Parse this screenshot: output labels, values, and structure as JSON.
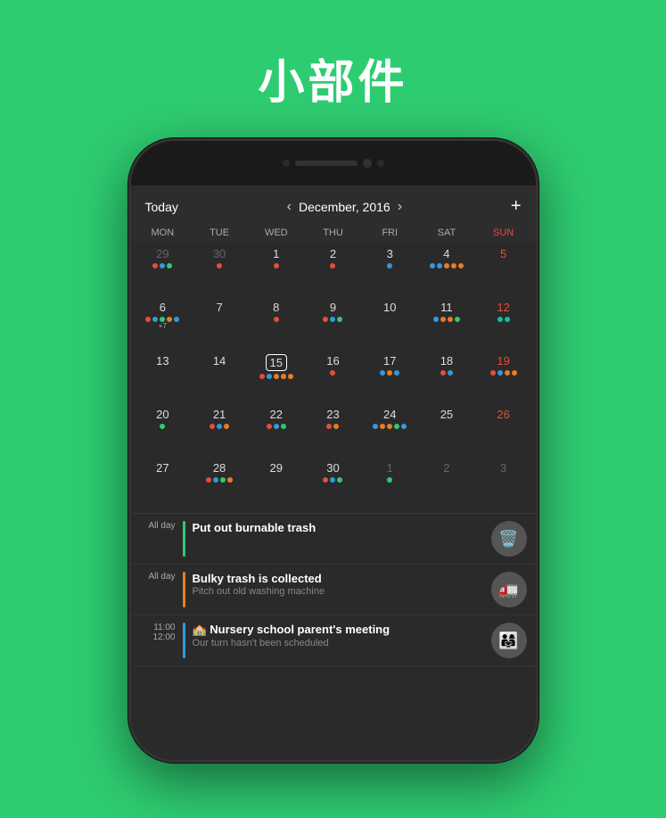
{
  "page": {
    "title": "小部件",
    "background_color": "#2ecc71"
  },
  "calendar": {
    "today_label": "Today",
    "month_label": "December, 2016",
    "prev_arrow": "‹",
    "next_arrow": "›",
    "add_btn": "+",
    "day_headers": [
      "MON",
      "TUE",
      "WED",
      "THU",
      "FRI",
      "SAT",
      "SUN"
    ],
    "weeks": [
      [
        {
          "num": "29",
          "dots": [
            "red",
            "blue",
            "green"
          ],
          "other": true
        },
        {
          "num": "30",
          "dots": [
            "red"
          ],
          "other": true
        },
        {
          "num": "1",
          "dots": [
            "red"
          ]
        },
        {
          "num": "2",
          "dots": [
            "red"
          ],
          "thu": true
        },
        {
          "num": "3",
          "dots": [
            "blue"
          ]
        },
        {
          "num": "4",
          "dots": [
            "blue",
            "blue",
            "orange",
            "orange",
            "orange"
          ]
        },
        {
          "num": "5",
          "dots": [],
          "sun": true
        }
      ],
      [
        {
          "num": "6",
          "dots": [
            "red",
            "blue",
            "green",
            "orange",
            "blue"
          ],
          "more": "+7"
        },
        {
          "num": "7",
          "dots": []
        },
        {
          "num": "8",
          "dots": [
            "red"
          ]
        },
        {
          "num": "9",
          "dots": [
            "red",
            "blue",
            "green"
          ]
        },
        {
          "num": "10",
          "dots": []
        },
        {
          "num": "11",
          "dots": [
            "blue",
            "orange",
            "orange",
            "green"
          ]
        },
        {
          "num": "12",
          "dots": [
            "teal",
            "teal"
          ],
          "sun": true
        }
      ],
      [
        {
          "num": "13",
          "dots": []
        },
        {
          "num": "14",
          "dots": []
        },
        {
          "num": "15",
          "dots": [
            "red",
            "blue",
            "orange",
            "orange",
            "orange"
          ],
          "today": true
        },
        {
          "num": "16",
          "dots": [
            "red"
          ]
        },
        {
          "num": "17",
          "dots": [
            "blue",
            "orange",
            "blue"
          ]
        },
        {
          "num": "18",
          "dots": [
            "red",
            "blue"
          ]
        },
        {
          "num": "19",
          "dots": [
            "red",
            "blue",
            "orange",
            "orange"
          ],
          "sun": true
        }
      ],
      [
        {
          "num": "20",
          "dots": [
            "green"
          ]
        },
        {
          "num": "21",
          "dots": [
            "red",
            "blue",
            "orange"
          ]
        },
        {
          "num": "22",
          "dots": [
            "red",
            "blue",
            "green"
          ]
        },
        {
          "num": "23",
          "dots": [
            "red",
            "orange"
          ]
        },
        {
          "num": "24",
          "dots": [
            "blue",
            "orange",
            "orange",
            "green",
            "blue"
          ]
        },
        {
          "num": "25",
          "dots": []
        },
        {
          "num": "26",
          "dots": [],
          "sun": true
        }
      ],
      [
        {
          "num": "27",
          "dots": []
        },
        {
          "num": "28",
          "dots": [
            "red",
            "blue",
            "green",
            "orange"
          ]
        },
        {
          "num": "29",
          "dots": []
        },
        {
          "num": "30",
          "dots": [
            "red",
            "blue",
            "green"
          ]
        },
        {
          "num": "1",
          "dots": [
            "green"
          ],
          "other": true
        },
        {
          "num": "2",
          "dots": [],
          "other": true
        },
        {
          "num": "3",
          "dots": [],
          "sun": true,
          "other": true
        }
      ]
    ]
  },
  "events": [
    {
      "time": "All day",
      "bar_color": "green",
      "title": "Put out burnable trash",
      "subtitle": "",
      "avatar": "🗑️"
    },
    {
      "time": "All day",
      "bar_color": "orange",
      "title": "Bulky trash is collected",
      "subtitle": "Pitch out old washing machine",
      "avatar": "🚛"
    },
    {
      "time": "11:00",
      "time2": "12:00",
      "bar_color": "blue",
      "title": "🏫 Nursery school parent's meeting",
      "subtitle": "Our turn hasn't been scheduled",
      "avatar": "👨‍👩‍👧"
    }
  ]
}
